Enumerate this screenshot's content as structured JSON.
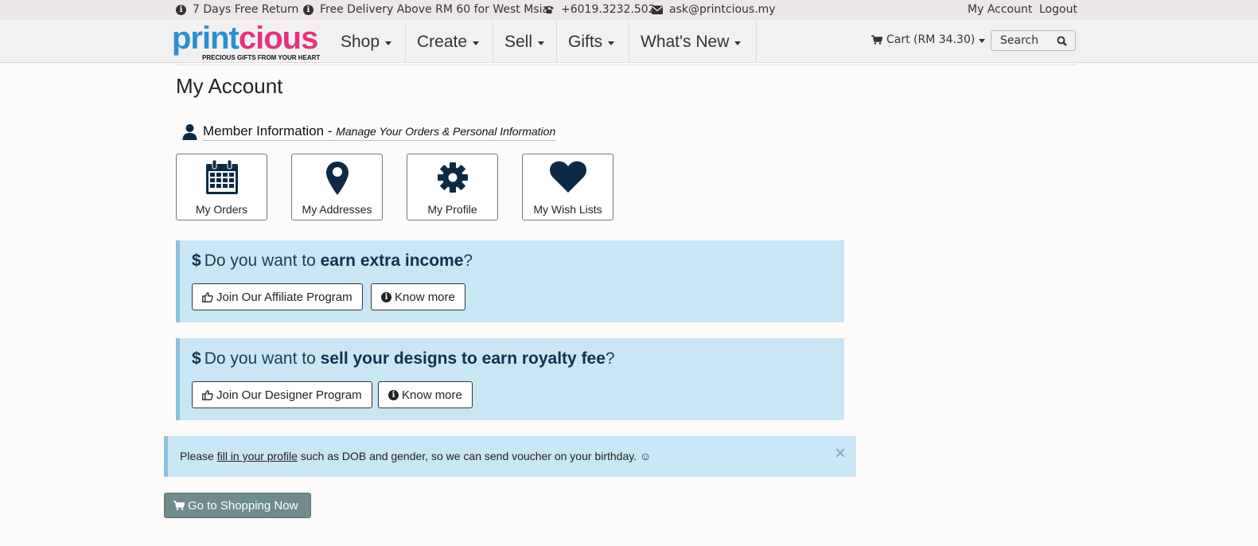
{
  "topbar": {
    "return_text": "7 Days Free Return",
    "delivery_text": "Free Delivery Above RM 60 for West Msia",
    "phone": "+6019.3232.502",
    "email": "ask@printcious.my",
    "my_account": "My Account",
    "logout": "Logout"
  },
  "logo": {
    "part1": "print",
    "part2": "cious",
    "tagline": "PRECIOUS GIFTS FROM YOUR HEART"
  },
  "nav": {
    "items": [
      {
        "label": "Shop"
      },
      {
        "label": "Create"
      },
      {
        "label": "Sell"
      },
      {
        "label": "Gifts"
      },
      {
        "label": "What's New"
      }
    ],
    "cart": "Cart (RM 34.30)",
    "search_placeholder": "Search"
  },
  "page": {
    "title": "My Account"
  },
  "member": {
    "title": "Member Information -",
    "subtitle": "Manage Your Orders & Personal Information",
    "tiles": [
      {
        "label": "My Orders",
        "icon": "calendar-icon"
      },
      {
        "label": "My Addresses",
        "icon": "map-marker-icon"
      },
      {
        "label": "My Profile",
        "icon": "gear-icon"
      },
      {
        "label": "My Wish Lists",
        "icon": "heart-icon"
      }
    ]
  },
  "affiliate": {
    "dollar": "$",
    "q_prefix": "Do you want to",
    "q_bold": "earn extra income",
    "q_suffix": "?",
    "join_label": "Join Our Affiliate Program",
    "know_label": "Know more"
  },
  "designer": {
    "dollar": "$",
    "q_prefix": "Do you want to",
    "q_bold": "sell your designs to earn royalty fee",
    "q_suffix": "?",
    "join_label": "Join Our Designer Program",
    "know_label": "Know more"
  },
  "notice": {
    "prefix": "Please",
    "link": "fill in your profile",
    "suffix": "such as DOB and gender, so we can send voucher on your birthday. ☺",
    "close": "×"
  },
  "shop_button": "Go to Shopping Now",
  "colors": {
    "brand_blue": "#2a8fd6",
    "brand_pink": "#e8317d",
    "panel_bg": "#c9e6f5",
    "icon_navy": "#0d2a45",
    "shop_button_bg": "#6f8b8b"
  }
}
